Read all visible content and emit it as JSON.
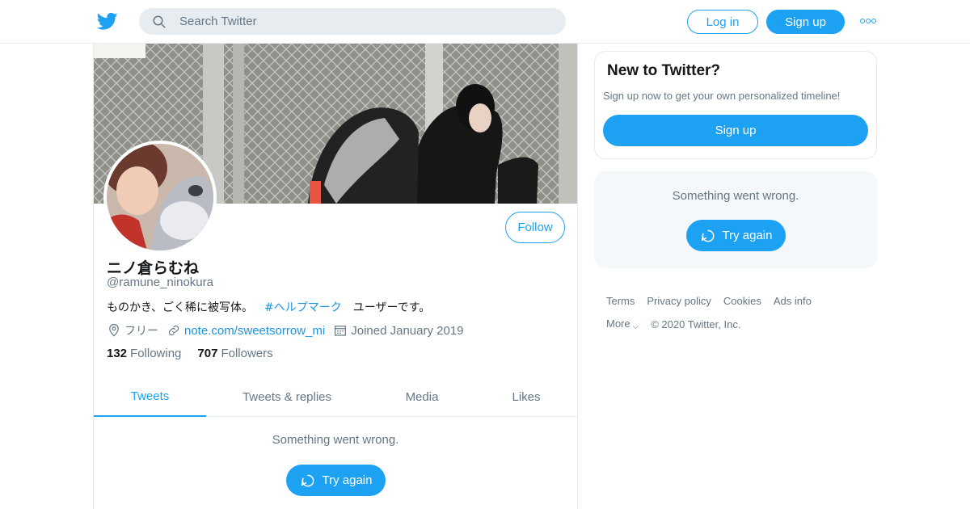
{
  "header": {
    "logo_icon": "twitter-bird-icon",
    "search_placeholder": "Search Twitter",
    "login_label": "Log in",
    "signup_label": "Sign up",
    "more_icon": "more-dots-icon"
  },
  "profile": {
    "display_name": "ニノ倉らむね",
    "handle": "@ramune_ninokura",
    "follow_label": "Follow",
    "bio_prefix": "ものかき、ごく稀に被写体。",
    "bio_hashtag": "#ヘルプマーク",
    "bio_suffix": "ユーザーです。",
    "location": "フリー",
    "url": "note.com/sweetsorrow_mi",
    "joined": "Joined January 2019",
    "following_count": "132",
    "following_label": "Following",
    "followers_count": "707",
    "followers_label": "Followers"
  },
  "tabs": [
    {
      "label": "Tweets",
      "active": true
    },
    {
      "label": "Tweets & replies",
      "active": false
    },
    {
      "label": "Media",
      "active": false
    },
    {
      "label": "Likes",
      "active": false
    }
  ],
  "timeline": {
    "error_message": "Something went wrong.",
    "retry_label": "Try again"
  },
  "sidebar": {
    "new_title": "New to Twitter?",
    "new_subtitle": "Sign up now to get your own personalized timeline!",
    "new_signup_label": "Sign up",
    "error_message": "Something went wrong.",
    "retry_label": "Try again"
  },
  "footer": {
    "links": [
      "Terms",
      "Privacy policy",
      "Cookies",
      "Ads info"
    ],
    "more_label": "More",
    "copyright": "© 2020 Twitter, Inc."
  },
  "colors": {
    "accent": "#1da1f2",
    "secondary_text": "#657786",
    "border": "#e6ecf0"
  }
}
